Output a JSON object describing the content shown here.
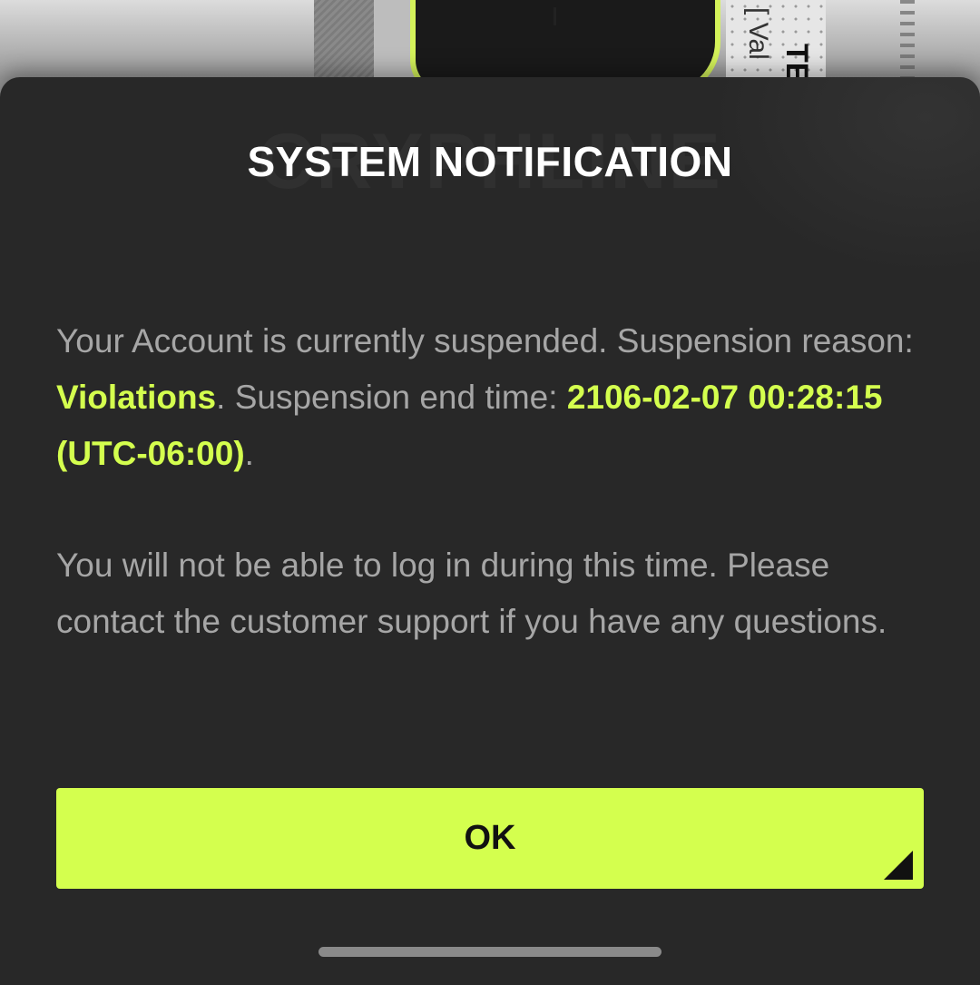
{
  "background": {
    "vertical_text": "[ Val",
    "vertical_title": "TE"
  },
  "modal": {
    "watermark": "CRYPHLINE",
    "title": "SYSTEM NOTIFICATION",
    "message1": {
      "prefix": "Your Account is currently suspended. Suspension reason: ",
      "reason": "Violations",
      "middle": ". Suspension end time: ",
      "end_time": "2106-02-07 00:28:15 (UTC-06:00)",
      "suffix": "."
    },
    "message2": "You will not be able to log in during this time. Please contact the customer support if you have any questions.",
    "ok_label": "OK"
  },
  "colors": {
    "accent": "#d4ff4e",
    "modal_bg": "#282828",
    "body_text": "#a6a6a6",
    "title_text": "#ffffff"
  }
}
